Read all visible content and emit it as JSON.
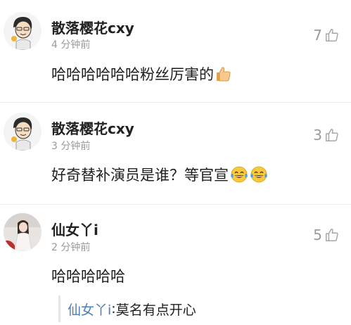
{
  "comments": [
    {
      "username": "散落樱花cxy",
      "time": "4 分钟前",
      "likes": "7",
      "content": "哈哈哈哈哈哈粉丝厉害的",
      "emoji": "thumbs-up"
    },
    {
      "username": "散落樱花cxy",
      "time": "3 分钟前",
      "likes": "3",
      "content": "好奇替补演员是谁？等官宣",
      "emoji": "tears-of-joy x2"
    },
    {
      "username": "仙女丫i",
      "time": "2 分钟前",
      "likes": "5",
      "content": "哈哈哈哈哈",
      "reply": {
        "name": "仙女丫i",
        "separator": ": ",
        "text": "莫名有点开心"
      }
    }
  ],
  "colors": {
    "username": "#222222",
    "meta": "#9a9a9a",
    "reply_name": "#4a7fb8"
  }
}
